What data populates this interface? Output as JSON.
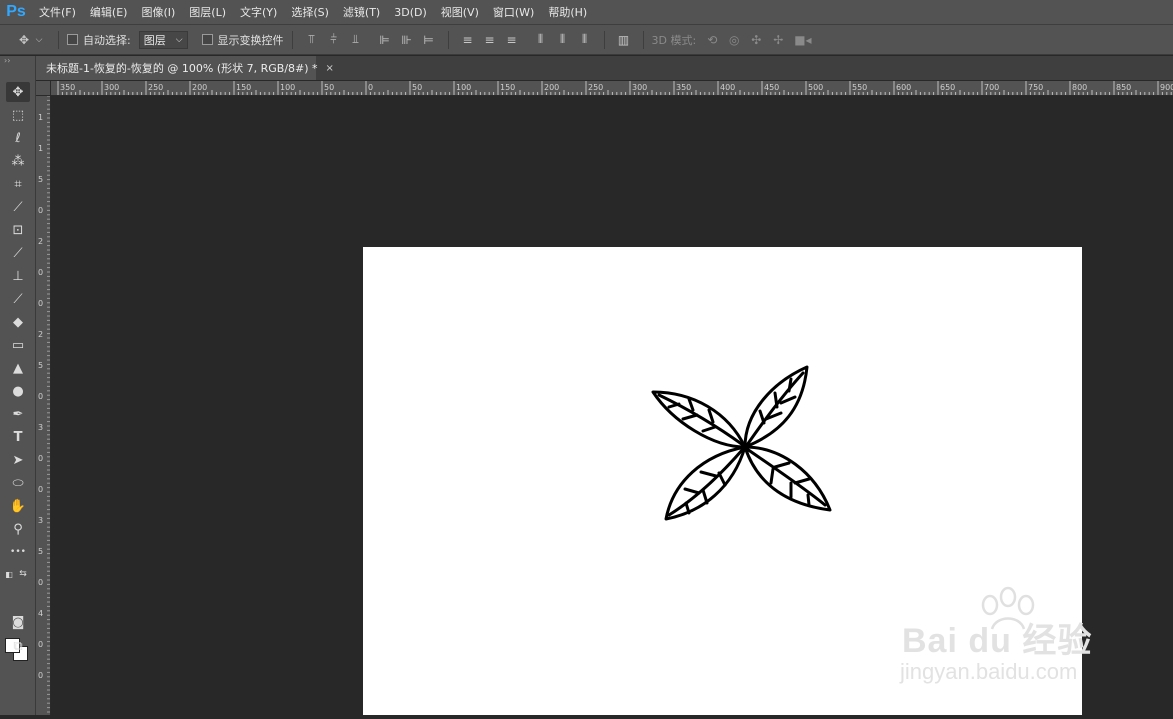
{
  "app": {
    "logo": "Ps"
  },
  "menu": [
    "文件(F)",
    "编辑(E)",
    "图像(I)",
    "图层(L)",
    "文字(Y)",
    "选择(S)",
    "滤镜(T)",
    "3D(D)",
    "视图(V)",
    "窗口(W)",
    "帮助(H)"
  ],
  "options": {
    "auto_select_label": "自动选择:",
    "auto_select_value": "图层",
    "show_transform_label": "显示变换控件",
    "mode_3d_label": "3D 模式:"
  },
  "document": {
    "tab_title": "未标题-1-恢复的-恢复的 @ 100% (形状 7, RGB/8#) *",
    "close_glyph": "×"
  },
  "ruler_h_labels": [
    "350",
    "300",
    "250",
    "200",
    "150",
    "100",
    "50",
    "0",
    "50",
    "100",
    "150",
    "200",
    "250",
    "300",
    "350",
    "400",
    "450",
    "500",
    "550",
    "600",
    "650",
    "700",
    "750",
    "800",
    "850",
    "900"
  ],
  "ruler_v_labels": [
    "1",
    "1",
    "5",
    "0",
    "2",
    "0",
    "0",
    "2",
    "5",
    "0",
    "3",
    "0",
    "0",
    "3",
    "5",
    "0",
    "4",
    "0",
    "0"
  ],
  "tools": [
    {
      "name": "move-tool-icon",
      "glyph": "✥"
    },
    {
      "name": "marquee-tool-icon",
      "glyph": "⬚"
    },
    {
      "name": "lasso-tool-icon",
      "glyph": "ℓ"
    },
    {
      "name": "magic-wand-tool-icon",
      "glyph": "⁂"
    },
    {
      "name": "crop-tool-icon",
      "glyph": "⌗"
    },
    {
      "name": "eyedropper-tool-icon",
      "glyph": "⟋"
    },
    {
      "name": "patch-tool-icon",
      "glyph": "⊡"
    },
    {
      "name": "brush-tool-icon",
      "glyph": "⟋"
    },
    {
      "name": "stamp-tool-icon",
      "glyph": "⊥"
    },
    {
      "name": "history-brush-tool-icon",
      "glyph": "⟋"
    },
    {
      "name": "eraser-tool-icon",
      "glyph": "◆"
    },
    {
      "name": "gradient-tool-icon",
      "glyph": "▭"
    },
    {
      "name": "blur-tool-icon",
      "glyph": "▲"
    },
    {
      "name": "dodge-tool-icon",
      "glyph": "●"
    },
    {
      "name": "pen-tool-icon",
      "glyph": "✒"
    },
    {
      "name": "type-tool-icon",
      "glyph": "T"
    },
    {
      "name": "path-selection-tool-icon",
      "glyph": "➤"
    },
    {
      "name": "ellipse-tool-icon",
      "glyph": "⬭"
    },
    {
      "name": "hand-tool-icon",
      "glyph": "✋"
    },
    {
      "name": "zoom-tool-icon",
      "glyph": "⚲"
    },
    {
      "name": "more-tools-icon",
      "glyph": "•••"
    }
  ],
  "watermark": {
    "brand": "Bai du 经验",
    "url": "jingyan.baidu.com"
  },
  "colors": {
    "accent": "#31a8ff",
    "panel": "#535353",
    "workspace": "#282828"
  }
}
